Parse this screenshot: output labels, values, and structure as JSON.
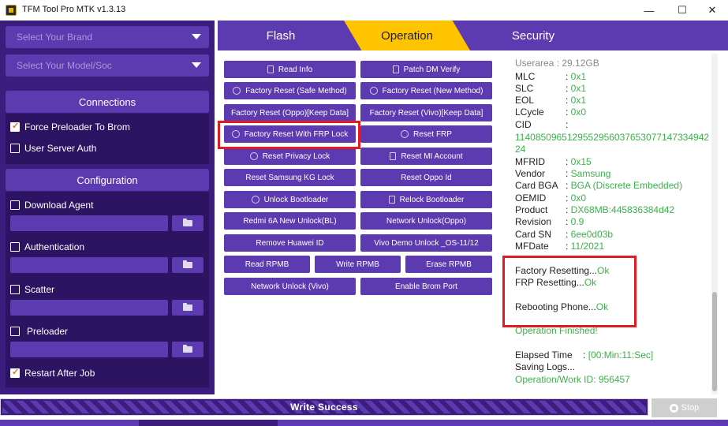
{
  "window": {
    "title": "TFM Tool Pro MTK v1.3.13",
    "minimize": "—",
    "maximize": "☐",
    "close": "✕"
  },
  "left": {
    "brand_placeholder": "Select Your Brand",
    "model_placeholder": "Select Your Model/Soc",
    "connections": {
      "title": "Connections",
      "force_preloader": "Force Preloader To  Brom",
      "force_preloader_checked": true,
      "user_server_auth": "User Server Auth",
      "user_server_auth_checked": false
    },
    "configuration": {
      "title": "Configuration",
      "download_agent": "Download Agent",
      "authentication": "Authentication",
      "scatter": "Scatter",
      "preloader": "Preloader",
      "restart_after_job": "Restart After Job",
      "restart_after_job_checked": true
    }
  },
  "tabs": [
    {
      "label": "Flash",
      "active": false
    },
    {
      "label": "Operation",
      "active": true
    },
    {
      "label": "Security",
      "active": false
    }
  ],
  "operations": [
    {
      "label": "Read Info",
      "icon": "doc-icon"
    },
    {
      "label": "Patch DM Verify",
      "icon": "doc-icon"
    },
    {
      "label": "Factory Reset (Safe Method)",
      "icon": "shield-icon"
    },
    {
      "label": "Factory Reset (New Method)",
      "icon": "shield-icon"
    },
    {
      "label": "Factory Reset (Oppo)[Keep Data]",
      "icon": ""
    },
    {
      "label": "Factory Reset (Vivo)[Keep Data]",
      "icon": ""
    },
    {
      "label": "Factory Reset With FRP Lock",
      "icon": "google-icon"
    },
    {
      "label": "Reset FRP",
      "icon": "google-icon"
    },
    {
      "label": "Reset Privacy Lock",
      "icon": "shield-icon"
    },
    {
      "label": "Reset MI Account",
      "icon": "doc-icon"
    },
    {
      "label": "Reset Samsung KG Lock",
      "icon": ""
    },
    {
      "label": "Reset Oppo Id",
      "icon": ""
    },
    {
      "label": "Unlock Bootloader",
      "icon": "shield-icon"
    },
    {
      "label": "Relock Bootloader",
      "icon": "doc-icon"
    },
    {
      "label": "Redmi 6A New Unlock(BL)",
      "icon": ""
    },
    {
      "label": "Network Unlock(Oppo)",
      "icon": ""
    },
    {
      "label": "Remove Huawei ID",
      "icon": ""
    },
    {
      "label": "Vivo Demo Unlock _OS-11/12",
      "icon": ""
    },
    {
      "label": "Read RPMB",
      "icon": ""
    },
    {
      "label": "Write RPMB",
      "icon": ""
    },
    {
      "label": "Erase RPMB",
      "icon": ""
    },
    {
      "label": "Network Unlock (Vivo)",
      "icon": ""
    },
    {
      "label": "Enable Brom Port",
      "icon": ""
    }
  ],
  "log": {
    "partial_top": "Userarea      : 29.12GB",
    "fields": [
      {
        "k": "MLC",
        "v": "0x1"
      },
      {
        "k": "SLC",
        "v": "0x1"
      },
      {
        "k": "EOL",
        "v": "0x1"
      },
      {
        "k": "LCycle",
        "v": "0x0"
      },
      {
        "k": "CID",
        "v": ""
      }
    ],
    "cid_value": "114085096512955295603765307714733494224",
    "fields2": [
      {
        "k": "MFRID",
        "v": "0x15"
      },
      {
        "k": "Vendor",
        "v": "Samsung"
      },
      {
        "k": "Card BGA",
        "v": "BGA (Discrete Embedded)"
      },
      {
        "k": "OEMID",
        "v": "0x0"
      },
      {
        "k": "Product",
        "v": "DX68MB:445836384d42"
      },
      {
        "k": "Revision",
        "v": "0.9"
      },
      {
        "k": "Card SN",
        "v": "6ee0d03b"
      },
      {
        "k": "MFDate",
        "v": "11/2021"
      }
    ],
    "factory_resetting": "Factory Resetting...",
    "frp_resetting": "FRP Resetting...",
    "rebooting": "Rebooting Phone...",
    "ok": "Ok",
    "operation_finished": "Operation Finished!",
    "elapsed_label": "Elapsed Time    :",
    "elapsed_value": "[00:Min:11:Sec]",
    "saving_logs": "Saving Logs...",
    "work_id": "Operation/Work ID: 956457"
  },
  "status": {
    "progress_text": "Write Success",
    "progress": 1.0,
    "stop_label": "Stop"
  }
}
